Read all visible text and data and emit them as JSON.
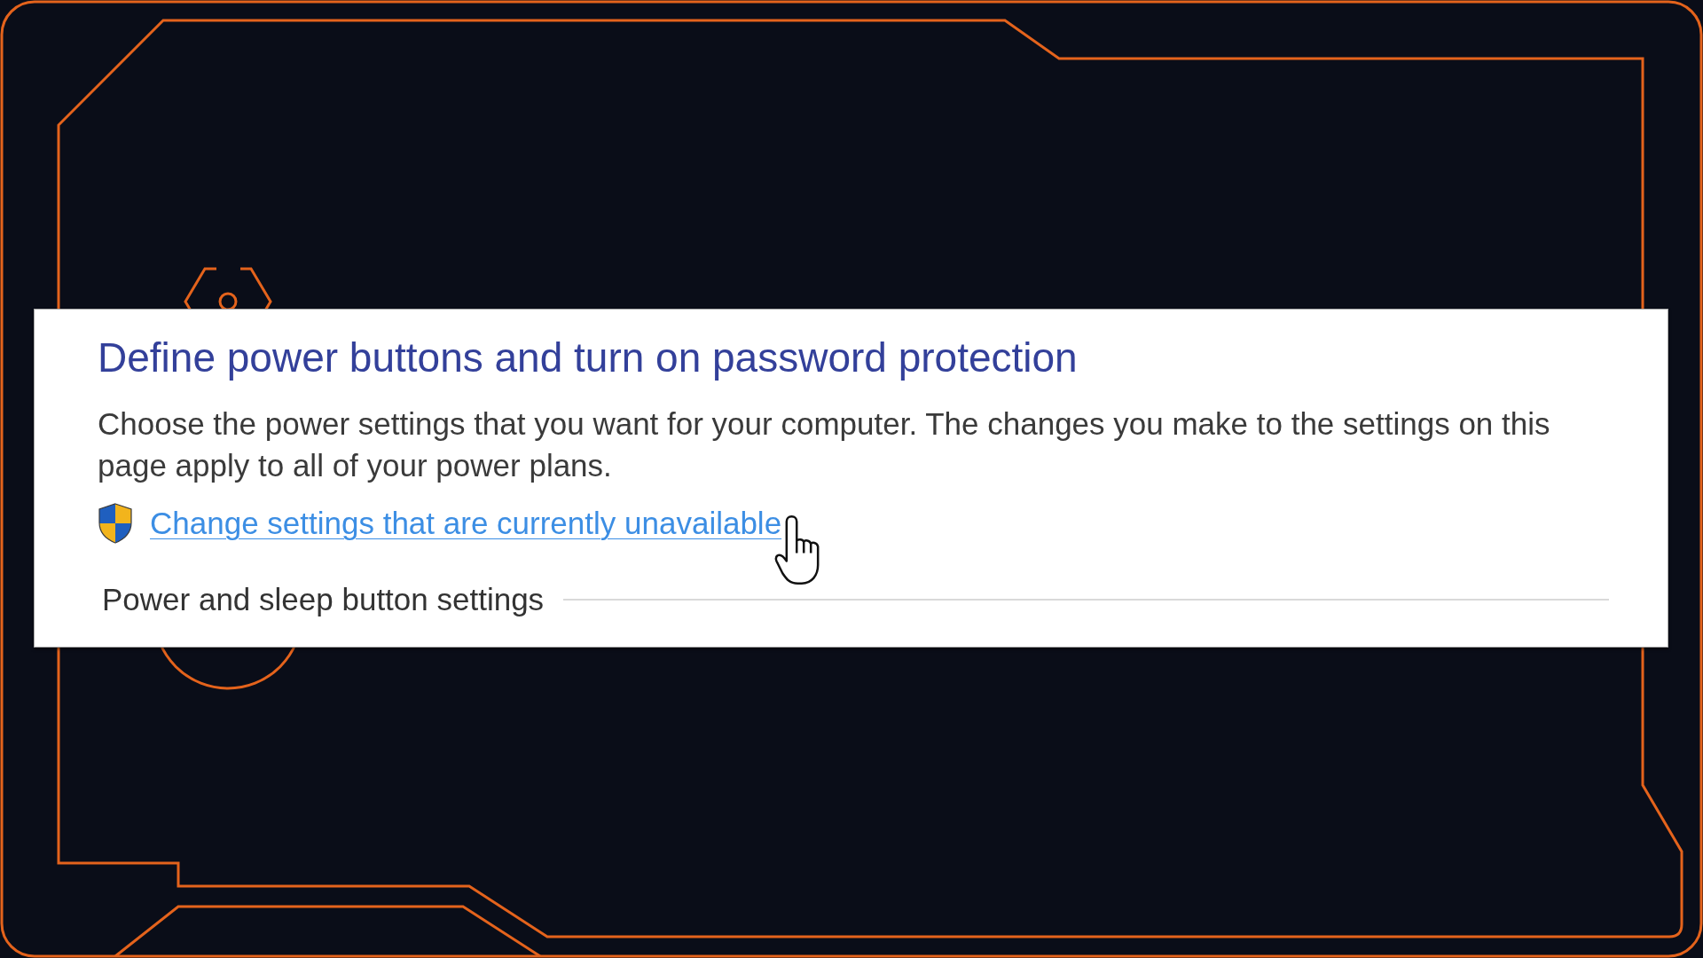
{
  "panel": {
    "title": "Define power buttons and turn on password protection",
    "description": "Choose the power settings that you want for your computer. The changes you make to the settings on this page apply to all of your power plans.",
    "admin_link": {
      "label": "Change settings that are currently unavailable"
    },
    "section": {
      "title": "Power and sleep button settings"
    }
  }
}
